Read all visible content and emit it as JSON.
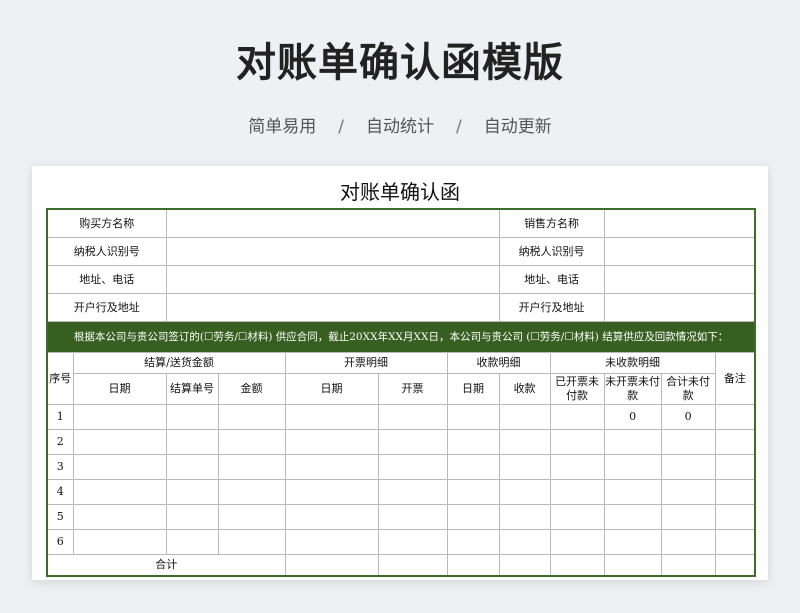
{
  "header": {
    "title": "对账单确认函模版",
    "features": [
      "简单易用",
      "自动统计",
      "自动更新"
    ],
    "separator": "/"
  },
  "document": {
    "title": "对账单确认函",
    "buyer_name_label": "购买方名称",
    "buyer_tax_label": "纳税人识别号",
    "buyer_addr_label": "地址、电话",
    "buyer_bank_label": "开户行及地址",
    "seller_name_label": "销售方名称",
    "seller_tax_label": "纳税人识别号",
    "seller_addr_label": "地址、电话",
    "seller_bank_label": "开户行及地址",
    "note": "根据本公司与贵公司签订的(☐劳务/☐材料) 供应合同，截止20XX年XX月XX日，本公司与贵公司 (☐劳务/☐材料) 结算供应及回款情况如下：",
    "table": {
      "col_seq": "序号",
      "group_settlement": "结算/送货金额",
      "group_invoice": "开票明细",
      "group_receipt": "收款明细",
      "group_unreceived": "未收款明细",
      "col_remark": "备注",
      "col_date": "日期",
      "col_settle_no": "结算单号",
      "col_amount": "金额",
      "col_invoice_date": "日期",
      "col_invoice": "开票",
      "col_receipt_date": "日期",
      "col_receipt": "收款",
      "col_invoiced_unpaid": "已开票未付款",
      "col_uninvoiced_unpaid": "未开票未付款",
      "col_total_unpaid": "合计未付款",
      "rows": [
        {
          "seq": "1",
          "uninvoiced_unpaid": "0",
          "total_unpaid": "0"
        },
        {
          "seq": "2",
          "uninvoiced_unpaid": "",
          "total_unpaid": ""
        },
        {
          "seq": "3",
          "uninvoiced_unpaid": "",
          "total_unpaid": ""
        },
        {
          "seq": "4",
          "uninvoiced_unpaid": "",
          "total_unpaid": ""
        },
        {
          "seq": "5",
          "uninvoiced_unpaid": "",
          "total_unpaid": ""
        },
        {
          "seq": "6",
          "uninvoiced_unpaid": "",
          "total_unpaid": ""
        }
      ],
      "total_label": "合计"
    }
  }
}
